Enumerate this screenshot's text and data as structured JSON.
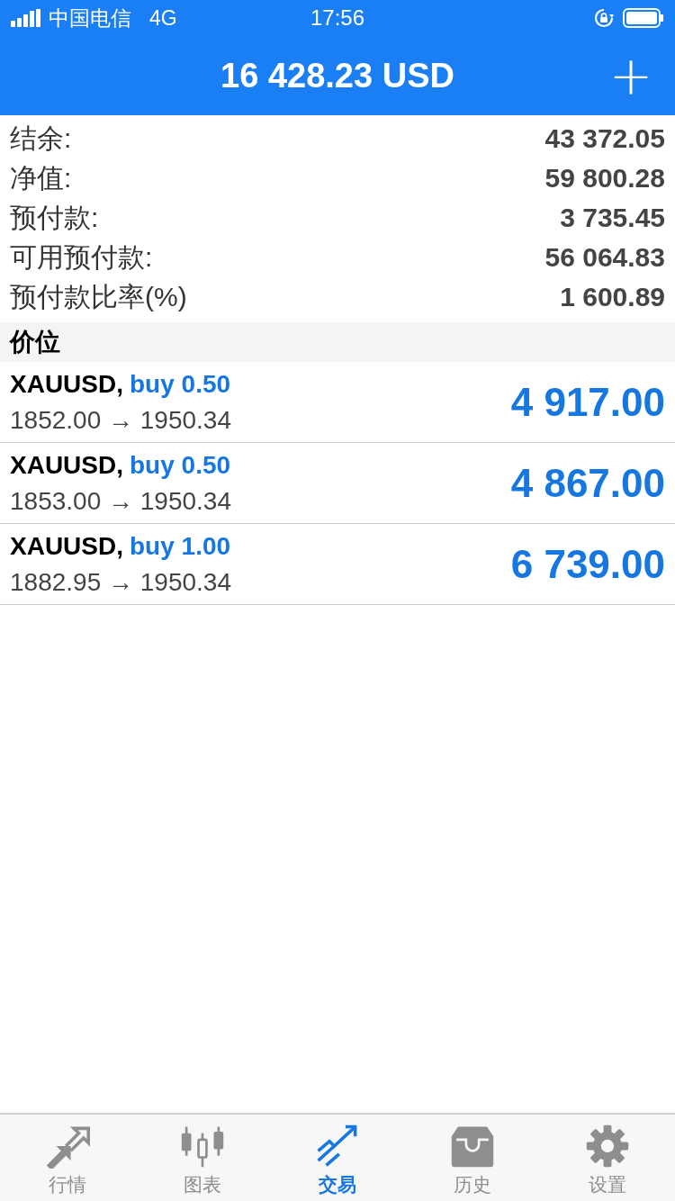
{
  "status_bar": {
    "carrier": "中国电信",
    "network": "4G",
    "time": "17:56"
  },
  "header": {
    "title": "16 428.23 USD",
    "add": "+"
  },
  "summary": [
    {
      "label": "结余:",
      "value": "43 372.05"
    },
    {
      "label": "净值:",
      "value": "59 800.28"
    },
    {
      "label": "预付款:",
      "value": "3 735.45"
    },
    {
      "label": "可用预付款:",
      "value": "56 064.83"
    },
    {
      "label": "预付款比率(%)",
      "value": "1 600.89"
    }
  ],
  "section": {
    "title": "价位"
  },
  "positions": [
    {
      "symbol": "XAUUSD,",
      "order": "buy 0.50",
      "prices": "1852.00 → 1950.34",
      "profit": "4 917.00"
    },
    {
      "symbol": "XAUUSD,",
      "order": "buy 0.50",
      "prices": "1853.00 → 1950.34",
      "profit": "4 867.00"
    },
    {
      "symbol": "XAUUSD,",
      "order": "buy 1.00",
      "prices": "1882.95 → 1950.34",
      "profit": "6 739.00"
    }
  ],
  "tabs": [
    {
      "label": "行情",
      "kind": "quotes",
      "selected": false
    },
    {
      "label": "图表",
      "kind": "chart",
      "selected": false
    },
    {
      "label": "交易",
      "kind": "trade",
      "selected": true
    },
    {
      "label": "历史",
      "kind": "history",
      "selected": false
    },
    {
      "label": "设置",
      "kind": "settings",
      "selected": false
    }
  ]
}
